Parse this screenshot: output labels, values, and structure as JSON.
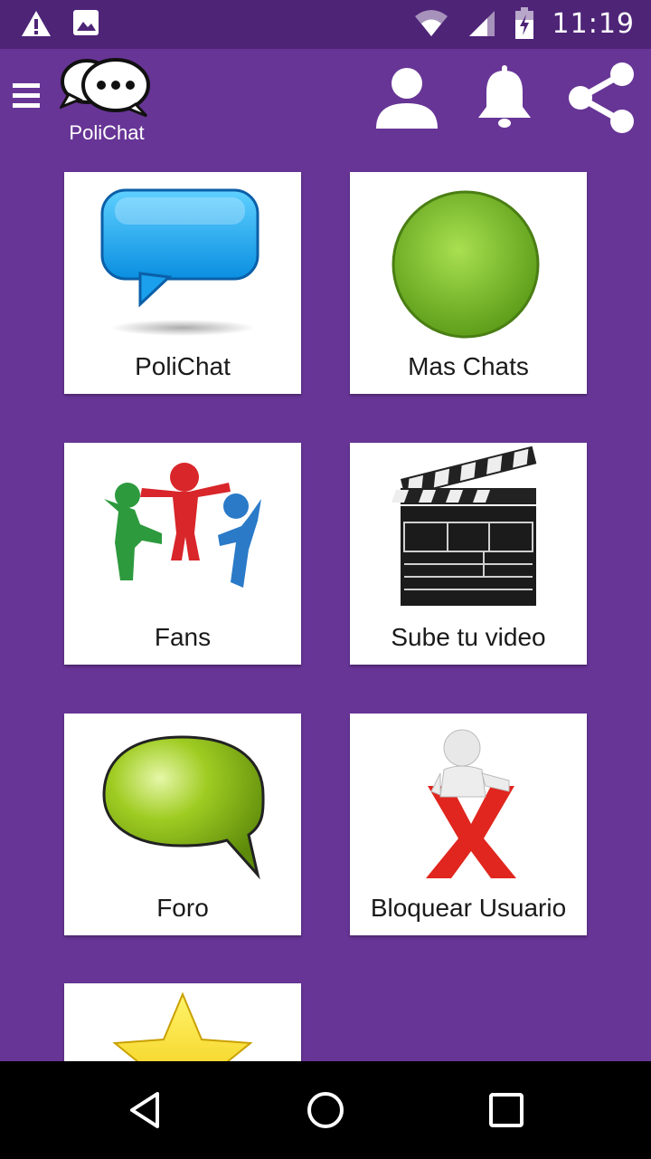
{
  "status_bar": {
    "time": "11:19",
    "left_icons": [
      "warning-icon",
      "image-icon"
    ],
    "right_icons": [
      "wifi-icon",
      "signal-icon",
      "battery-charging-icon"
    ]
  },
  "app_bar": {
    "app_name": "PoliChat",
    "icons": [
      "menu-icon",
      "profile-icon",
      "notifications-icon",
      "share-icon"
    ]
  },
  "tiles": [
    {
      "label": "PoliChat",
      "icon": "blue-speech-bubble-icon"
    },
    {
      "label": "Mas Chats",
      "icon": "green-circle-icon"
    },
    {
      "label": "Fans",
      "icon": "people-group-icon"
    },
    {
      "label": "Sube tu video",
      "icon": "clapperboard-icon"
    },
    {
      "label": "Foro",
      "icon": "green-speech-bubble-icon"
    },
    {
      "label": "Bloquear Usuario",
      "icon": "block-user-icon"
    },
    {
      "label": "",
      "icon": "star-icon"
    }
  ],
  "nav_bar": {
    "buttons": [
      "back-button",
      "home-button",
      "recents-button"
    ]
  },
  "colors": {
    "background": "#673596",
    "status_bar": "#4e2477",
    "tile": "#ffffff",
    "nav_bar": "#000000"
  }
}
